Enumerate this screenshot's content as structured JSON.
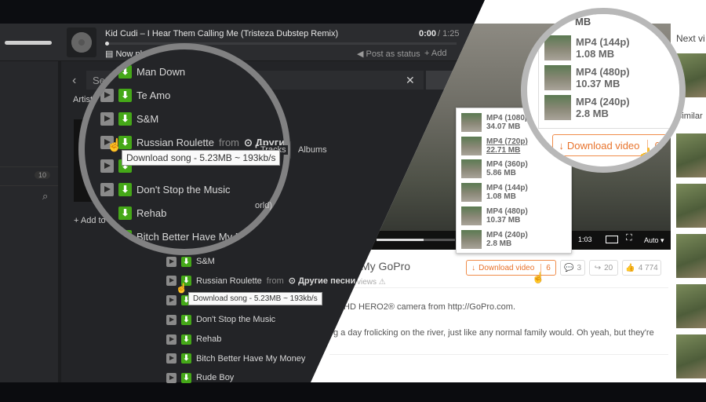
{
  "player": {
    "track": "Kid Cudi – I Hear Them Calling Me (Tristeza Dubstep Remix)",
    "time_current": "0:00",
    "time_total": "/ 1:25",
    "now_playing": "Now playing",
    "post_status": "Post as status",
    "add": "+ Add"
  },
  "search": {
    "placeholder": "Search"
  },
  "sidebar": {
    "badge": "10"
  },
  "music": {
    "artist_label": "Artist",
    "tab_tracks": "Tracks",
    "tab_albums": "Albums",
    "add_to_my": "+ Add to My",
    "from": "from",
    "album": "Другие песни",
    "world_fragment": "orld)"
  },
  "big_list": [
    "Man Down",
    "Te Amo",
    "S&M",
    "Russian Roulette",
    "",
    "Don't Stop the Music",
    "Rehab",
    "Bitch Better Have My M"
  ],
  "small_list": [
    "Te Amo",
    "S&M",
    "Russian Roulette",
    "",
    "Don't Stop the Music",
    "Rehab",
    "Bitch Better Have My Money",
    "Rude Boy"
  ],
  "tooltip": "Download song - 5.23MB ~ 193kb/s",
  "video": {
    "title_fragment": "My GoPro",
    "views_fragment": "views",
    "time": "1:03",
    "quality": "Auto ▾",
    "desc1": "HD HERO2® camera from http://GoPro.com.",
    "desc2": "g a day frolicking on the river, just like any normal family would. Oh yeah, but they're",
    "next": "Next vi",
    "similar": "Similar"
  },
  "download": {
    "label": "Download video",
    "count": "6",
    "comments": "3",
    "shares": "20",
    "likes": "4 774"
  },
  "formats": [
    {
      "name": "MP4 (1080p)",
      "size": "34.07 MB"
    },
    {
      "name": "MP4 (720p)",
      "size": "22.71 MB"
    },
    {
      "name": "MP4 (360p)",
      "size": "5.86 MB"
    },
    {
      "name": "MP4 (144p)",
      "size": "1.08 MB"
    },
    {
      "name": "MP4 (480p)",
      "size": "10.37 MB"
    },
    {
      "name": "MP4 (240p)",
      "size": "2.8 MB"
    }
  ],
  "colors": {
    "accent_orange": "#e8732c",
    "download_green": "#45a818"
  }
}
